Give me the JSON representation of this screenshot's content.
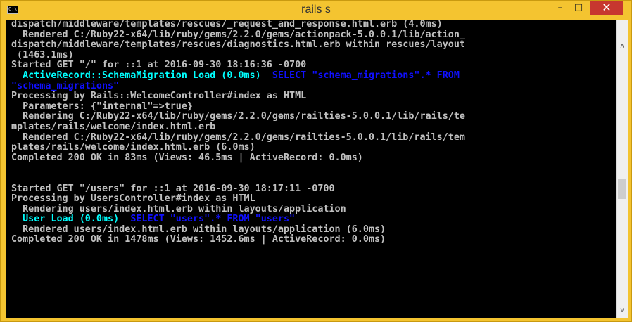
{
  "window": {
    "title": "rails s",
    "icon_text": "C:\\",
    "minimize_icon": "minimize-icon",
    "maximize_icon": "maximize-icon",
    "close_icon": "close-icon",
    "minimize_glyph": "–",
    "maximize_glyph": "□",
    "close_glyph": "✕"
  },
  "colors": {
    "titlebar": "#f4c430",
    "close_button": "#c7372f",
    "console_bg": "#000000",
    "text_default": "#c0c0c0",
    "text_cyan": "#00ffff",
    "text_blue": "#1010ff"
  },
  "console": {
    "lines": [
      [
        {
          "t": "dispatch/middleware/templates/rescues/_request_and_response.html.erb (4.0ms)",
          "c": "gray"
        }
      ],
      [
        {
          "t": "  Rendered C:/Ruby22-x64/lib/ruby/gems/2.2.0/gems/actionpack-5.0.0.1/lib/action_",
          "c": "gray"
        }
      ],
      [
        {
          "t": "dispatch/middleware/templates/rescues/diagnostics.html.erb within rescues/layout",
          "c": "gray"
        }
      ],
      [
        {
          "t": " (1463.1ms)",
          "c": "gray"
        }
      ],
      [
        {
          "t": "Started GET \"/\" for ::1 at 2016-09-30 18:16:36 -0700",
          "c": "gray"
        }
      ],
      [
        {
          "t": "  ActiveRecord::SchemaMigration Load (0.0ms)  ",
          "c": "cyan"
        },
        {
          "t": "SELECT \"schema_migrations\".* FROM",
          "c": "blue"
        }
      ],
      [
        {
          "t": "\"schema_migrations\"",
          "c": "blue"
        }
      ],
      [
        {
          "t": "Processing by Rails::WelcomeController#index as HTML",
          "c": "gray"
        }
      ],
      [
        {
          "t": "  Parameters: {\"internal\"=>true}",
          "c": "gray"
        }
      ],
      [
        {
          "t": "  Rendering C:/Ruby22-x64/lib/ruby/gems/2.2.0/gems/railties-5.0.0.1/lib/rails/te",
          "c": "gray"
        }
      ],
      [
        {
          "t": "mplates/rails/welcome/index.html.erb",
          "c": "gray"
        }
      ],
      [
        {
          "t": "  Rendered C:/Ruby22-x64/lib/ruby/gems/2.2.0/gems/railties-5.0.0.1/lib/rails/tem",
          "c": "gray"
        }
      ],
      [
        {
          "t": "plates/rails/welcome/index.html.erb (6.0ms)",
          "c": "gray"
        }
      ],
      [
        {
          "t": "Completed 200 OK in 83ms (Views: 46.5ms | ActiveRecord: 0.0ms)",
          "c": "gray"
        }
      ],
      [
        {
          "t": "",
          "c": "gray"
        }
      ],
      [
        {
          "t": "",
          "c": "gray"
        }
      ],
      [
        {
          "t": "Started GET \"/users\" for ::1 at 2016-09-30 18:17:11 -0700",
          "c": "gray"
        }
      ],
      [
        {
          "t": "Processing by UsersController#index as HTML",
          "c": "gray"
        }
      ],
      [
        {
          "t": "  Rendering users/index.html.erb within layouts/application",
          "c": "gray"
        }
      ],
      [
        {
          "t": "  User Load (0.0ms)  ",
          "c": "cyan"
        },
        {
          "t": "SELECT \"users\".* FROM \"users\"",
          "c": "blue"
        }
      ],
      [
        {
          "t": "  Rendered users/index.html.erb within layouts/application (6.0ms)",
          "c": "gray"
        }
      ],
      [
        {
          "t": "Completed 200 OK in 1478ms (Views: 1452.6ms | ActiveRecord: 0.0ms)",
          "c": "gray"
        }
      ]
    ]
  },
  "scrollbar": {
    "up_icon": "scroll-up-arrow-icon",
    "down_icon": "scroll-down-arrow-icon",
    "up_glyph": "∧",
    "down_glyph": "∨",
    "thumb_start_fraction": 0.5,
    "thumb_size_fraction": 0.08
  }
}
